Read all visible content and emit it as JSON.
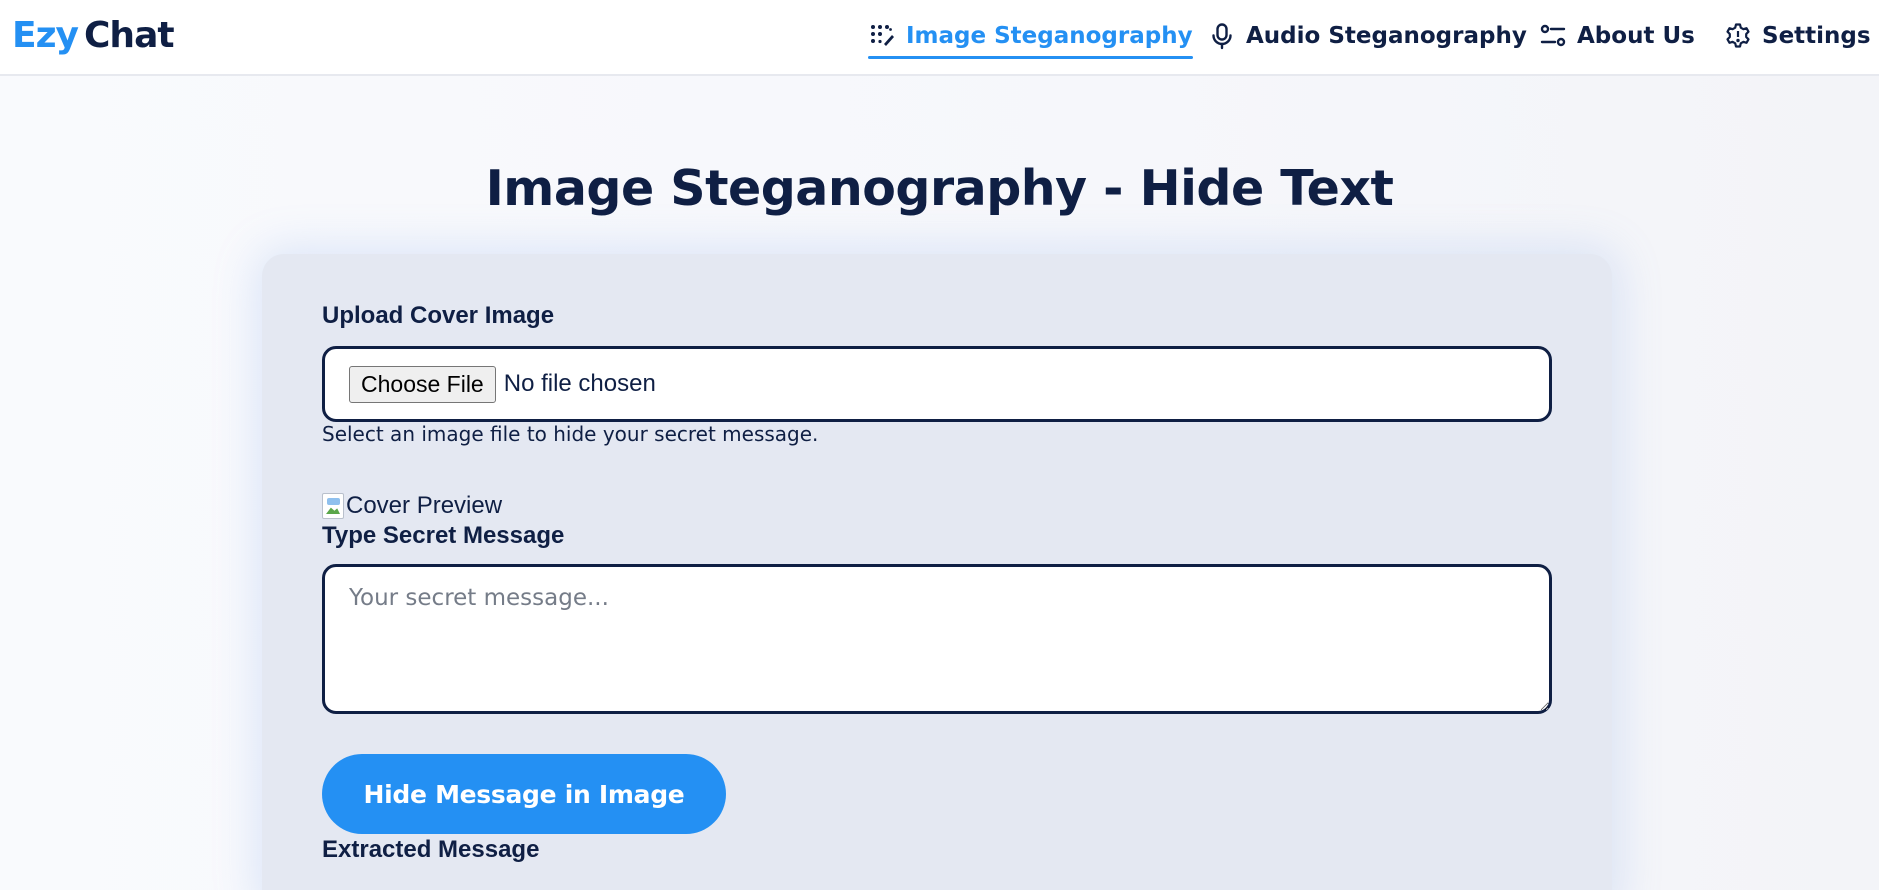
{
  "brand": {
    "part1": "Ezy",
    "part2": "Chat"
  },
  "nav": {
    "items": [
      {
        "label": "Image Steganography",
        "icon": "sparkle-grid-icon",
        "active": true
      },
      {
        "label": "Audio Steganography",
        "icon": "microphone-icon",
        "active": false
      },
      {
        "label": "About Us",
        "icon": "sliders-icon",
        "active": false
      },
      {
        "label": "Settings",
        "icon": "gear-icon",
        "active": false
      }
    ]
  },
  "page": {
    "title": "Image Steganography - Hide Text"
  },
  "form": {
    "upload_label": "Upload Cover Image",
    "choose_file_label": "Choose File",
    "file_status": "No file chosen",
    "upload_hint": "Select an image file to hide your secret message.",
    "preview_alt": "Cover Preview",
    "secret_label": "Type Secret Message",
    "secret_placeholder": "Your secret message...",
    "secret_value": "",
    "submit_label": "Hide Message in Image",
    "extracted_label": "Extracted Message"
  },
  "colors": {
    "accent": "#2490f3",
    "navy": "#0f1f44",
    "card_bg": "#e4e8f2"
  }
}
